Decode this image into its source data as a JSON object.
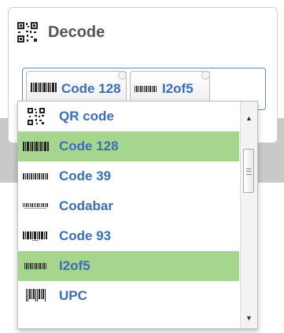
{
  "panel": {
    "title": "Decode",
    "icon": "qr-code-icon"
  },
  "selected": [
    {
      "label": "Code 128",
      "icon": "code-128-barcode-icon"
    },
    {
      "label": "I2of5",
      "icon": "i2of5-barcode-icon"
    }
  ],
  "options": [
    {
      "label": "QR code",
      "icon": "qr-code-icon",
      "selected": false
    },
    {
      "label": "Code 128",
      "icon": "code-128-barcode-icon",
      "selected": true
    },
    {
      "label": "Code 39",
      "icon": "code-39-barcode-icon",
      "selected": false
    },
    {
      "label": "Codabar",
      "icon": "codabar-barcode-icon",
      "selected": false
    },
    {
      "label": "Code 93",
      "icon": "code-93-barcode-icon",
      "selected": false
    },
    {
      "label": "I2of5",
      "icon": "i2of5-barcode-icon",
      "selected": true
    },
    {
      "label": "UPC",
      "icon": "upc-barcode-icon",
      "selected": false
    }
  ],
  "colors": {
    "accent_text": "#3b6fb5",
    "selected_bg": "#a6d58e",
    "border_focus": "#5b8bc6"
  }
}
